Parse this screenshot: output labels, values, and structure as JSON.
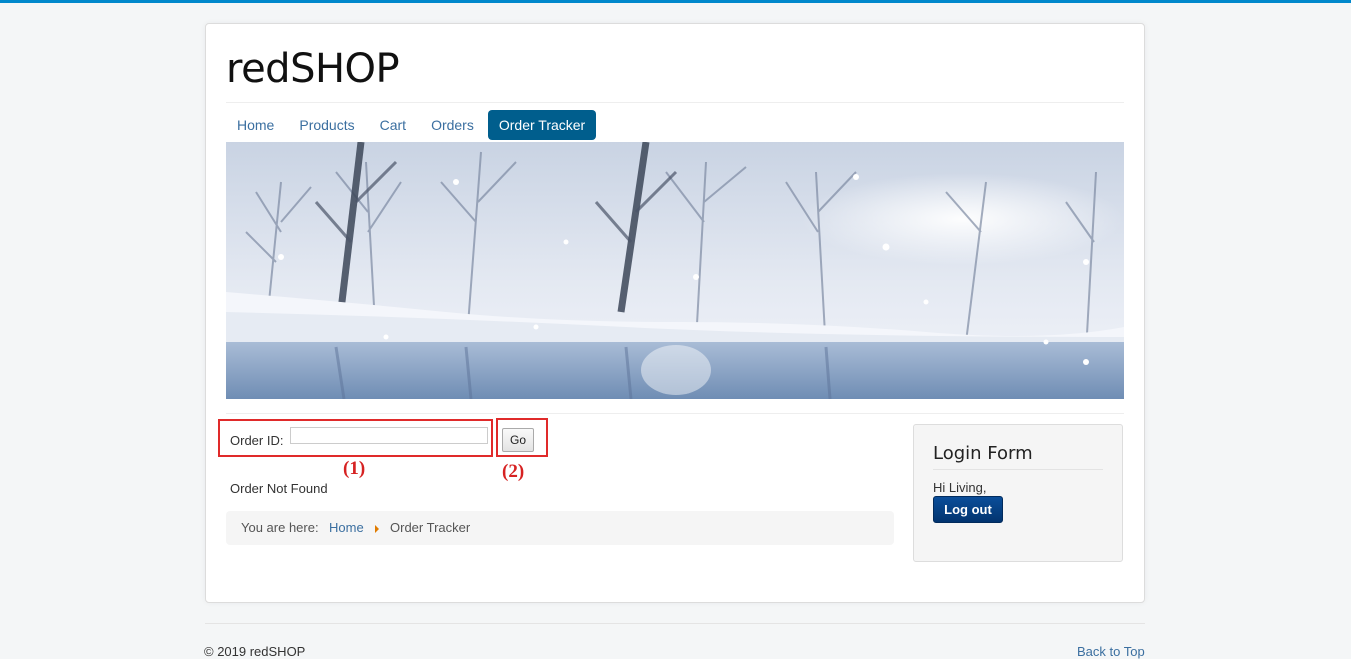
{
  "site": {
    "brand": "redSHOP"
  },
  "nav": {
    "items": [
      {
        "label": "Home",
        "active": false
      },
      {
        "label": "Products",
        "active": false
      },
      {
        "label": "Cart",
        "active": false
      },
      {
        "label": "Orders",
        "active": false
      },
      {
        "label": "Order Tracker",
        "active": true
      }
    ]
  },
  "tracker": {
    "order_id_label": "Order ID:",
    "order_id_value": "",
    "go_label": "Go",
    "annotation_1": "(1)",
    "annotation_2": "(2)",
    "status_text": "Order Not Found"
  },
  "breadcrumb": {
    "prefix": "You are here:",
    "items": [
      "Home",
      "Order Tracker"
    ]
  },
  "login": {
    "title": "Login Form",
    "greeting": "Hi Living,",
    "logout_label": "Log out"
  },
  "footer": {
    "copyright": "© 2019 redSHOP",
    "back_to_top": "Back to Top"
  },
  "colors": {
    "accent": "#005e8d",
    "link": "#3b6fa0",
    "annotation": "#d62222",
    "top_bar": "#0088cc"
  }
}
